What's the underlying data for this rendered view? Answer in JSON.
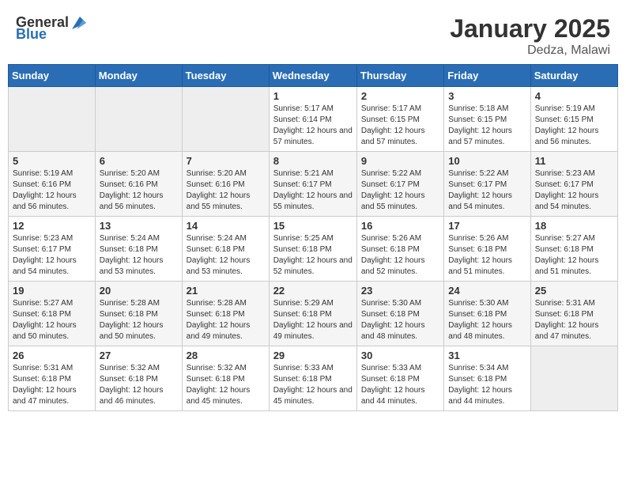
{
  "header": {
    "logo_general": "General",
    "logo_blue": "Blue",
    "month": "January 2025",
    "location": "Dedza, Malawi"
  },
  "weekdays": [
    "Sunday",
    "Monday",
    "Tuesday",
    "Wednesday",
    "Thursday",
    "Friday",
    "Saturday"
  ],
  "weeks": [
    [
      {
        "day": "",
        "sunrise": "",
        "sunset": "",
        "daylight": ""
      },
      {
        "day": "",
        "sunrise": "",
        "sunset": "",
        "daylight": ""
      },
      {
        "day": "",
        "sunrise": "",
        "sunset": "",
        "daylight": ""
      },
      {
        "day": "1",
        "sunrise": "Sunrise: 5:17 AM",
        "sunset": "Sunset: 6:14 PM",
        "daylight": "Daylight: 12 hours and 57 minutes."
      },
      {
        "day": "2",
        "sunrise": "Sunrise: 5:17 AM",
        "sunset": "Sunset: 6:15 PM",
        "daylight": "Daylight: 12 hours and 57 minutes."
      },
      {
        "day": "3",
        "sunrise": "Sunrise: 5:18 AM",
        "sunset": "Sunset: 6:15 PM",
        "daylight": "Daylight: 12 hours and 57 minutes."
      },
      {
        "day": "4",
        "sunrise": "Sunrise: 5:19 AM",
        "sunset": "Sunset: 6:15 PM",
        "daylight": "Daylight: 12 hours and 56 minutes."
      }
    ],
    [
      {
        "day": "5",
        "sunrise": "Sunrise: 5:19 AM",
        "sunset": "Sunset: 6:16 PM",
        "daylight": "Daylight: 12 hours and 56 minutes."
      },
      {
        "day": "6",
        "sunrise": "Sunrise: 5:20 AM",
        "sunset": "Sunset: 6:16 PM",
        "daylight": "Daylight: 12 hours and 56 minutes."
      },
      {
        "day": "7",
        "sunrise": "Sunrise: 5:20 AM",
        "sunset": "Sunset: 6:16 PM",
        "daylight": "Daylight: 12 hours and 55 minutes."
      },
      {
        "day": "8",
        "sunrise": "Sunrise: 5:21 AM",
        "sunset": "Sunset: 6:17 PM",
        "daylight": "Daylight: 12 hours and 55 minutes."
      },
      {
        "day": "9",
        "sunrise": "Sunrise: 5:22 AM",
        "sunset": "Sunset: 6:17 PM",
        "daylight": "Daylight: 12 hours and 55 minutes."
      },
      {
        "day": "10",
        "sunrise": "Sunrise: 5:22 AM",
        "sunset": "Sunset: 6:17 PM",
        "daylight": "Daylight: 12 hours and 54 minutes."
      },
      {
        "day": "11",
        "sunrise": "Sunrise: 5:23 AM",
        "sunset": "Sunset: 6:17 PM",
        "daylight": "Daylight: 12 hours and 54 minutes."
      }
    ],
    [
      {
        "day": "12",
        "sunrise": "Sunrise: 5:23 AM",
        "sunset": "Sunset: 6:17 PM",
        "daylight": "Daylight: 12 hours and 54 minutes."
      },
      {
        "day": "13",
        "sunrise": "Sunrise: 5:24 AM",
        "sunset": "Sunset: 6:18 PM",
        "daylight": "Daylight: 12 hours and 53 minutes."
      },
      {
        "day": "14",
        "sunrise": "Sunrise: 5:24 AM",
        "sunset": "Sunset: 6:18 PM",
        "daylight": "Daylight: 12 hours and 53 minutes."
      },
      {
        "day": "15",
        "sunrise": "Sunrise: 5:25 AM",
        "sunset": "Sunset: 6:18 PM",
        "daylight": "Daylight: 12 hours and 52 minutes."
      },
      {
        "day": "16",
        "sunrise": "Sunrise: 5:26 AM",
        "sunset": "Sunset: 6:18 PM",
        "daylight": "Daylight: 12 hours and 52 minutes."
      },
      {
        "day": "17",
        "sunrise": "Sunrise: 5:26 AM",
        "sunset": "Sunset: 6:18 PM",
        "daylight": "Daylight: 12 hours and 51 minutes."
      },
      {
        "day": "18",
        "sunrise": "Sunrise: 5:27 AM",
        "sunset": "Sunset: 6:18 PM",
        "daylight": "Daylight: 12 hours and 51 minutes."
      }
    ],
    [
      {
        "day": "19",
        "sunrise": "Sunrise: 5:27 AM",
        "sunset": "Sunset: 6:18 PM",
        "daylight": "Daylight: 12 hours and 50 minutes."
      },
      {
        "day": "20",
        "sunrise": "Sunrise: 5:28 AM",
        "sunset": "Sunset: 6:18 PM",
        "daylight": "Daylight: 12 hours and 50 minutes."
      },
      {
        "day": "21",
        "sunrise": "Sunrise: 5:28 AM",
        "sunset": "Sunset: 6:18 PM",
        "daylight": "Daylight: 12 hours and 49 minutes."
      },
      {
        "day": "22",
        "sunrise": "Sunrise: 5:29 AM",
        "sunset": "Sunset: 6:18 PM",
        "daylight": "Daylight: 12 hours and 49 minutes."
      },
      {
        "day": "23",
        "sunrise": "Sunrise: 5:30 AM",
        "sunset": "Sunset: 6:18 PM",
        "daylight": "Daylight: 12 hours and 48 minutes."
      },
      {
        "day": "24",
        "sunrise": "Sunrise: 5:30 AM",
        "sunset": "Sunset: 6:18 PM",
        "daylight": "Daylight: 12 hours and 48 minutes."
      },
      {
        "day": "25",
        "sunrise": "Sunrise: 5:31 AM",
        "sunset": "Sunset: 6:18 PM",
        "daylight": "Daylight: 12 hours and 47 minutes."
      }
    ],
    [
      {
        "day": "26",
        "sunrise": "Sunrise: 5:31 AM",
        "sunset": "Sunset: 6:18 PM",
        "daylight": "Daylight: 12 hours and 47 minutes."
      },
      {
        "day": "27",
        "sunrise": "Sunrise: 5:32 AM",
        "sunset": "Sunset: 6:18 PM",
        "daylight": "Daylight: 12 hours and 46 minutes."
      },
      {
        "day": "28",
        "sunrise": "Sunrise: 5:32 AM",
        "sunset": "Sunset: 6:18 PM",
        "daylight": "Daylight: 12 hours and 45 minutes."
      },
      {
        "day": "29",
        "sunrise": "Sunrise: 5:33 AM",
        "sunset": "Sunset: 6:18 PM",
        "daylight": "Daylight: 12 hours and 45 minutes."
      },
      {
        "day": "30",
        "sunrise": "Sunrise: 5:33 AM",
        "sunset": "Sunset: 6:18 PM",
        "daylight": "Daylight: 12 hours and 44 minutes."
      },
      {
        "day": "31",
        "sunrise": "Sunrise: 5:34 AM",
        "sunset": "Sunset: 6:18 PM",
        "daylight": "Daylight: 12 hours and 44 minutes."
      },
      {
        "day": "",
        "sunrise": "",
        "sunset": "",
        "daylight": ""
      }
    ]
  ]
}
